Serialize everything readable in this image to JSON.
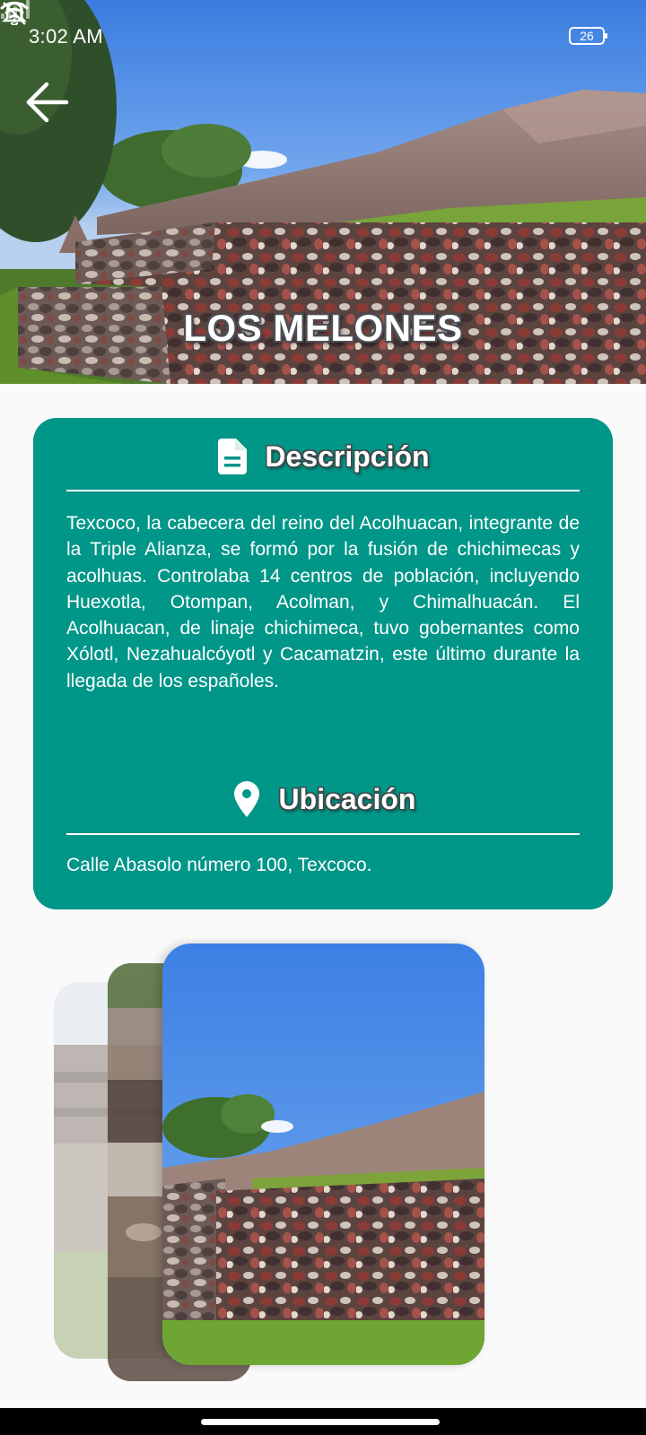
{
  "status_bar": {
    "time": "3:02 AM",
    "battery_level": "26",
    "icons": [
      "mute-icon",
      "signal-icon",
      "wifi-icon",
      "battery-icon"
    ]
  },
  "header": {
    "title": "LOS MELONES",
    "back_icon": "arrow-left-icon"
  },
  "description": {
    "heading": "Descripción",
    "icon": "document-icon",
    "text": "Texcoco, la cabecera del reino del Acolhuacan, integrante de la Triple Alianza, se formó por la fusión de chichimecas y acolhuas. Controlaba 14 centros de población, incluyendo Huexotla, Otompan, Acolman, y Chimalhuacán. El Acolhuacan, de linaje chichimeca, tuvo gobernantes como Xólotl, Nezahualcóyotl y Cacamatzin, este último durante la llegada de los españoles."
  },
  "location": {
    "heading": "Ubicación",
    "icon": "location-pin-icon",
    "text": "Calle Abasolo número 100, Texcoco."
  },
  "gallery": {
    "images": [
      "ruins-photo-1",
      "ruins-photo-2",
      "ruins-photo-3"
    ]
  },
  "colors": {
    "card_background": "#009688",
    "page_background": "#fafafa",
    "text": "#ffffff"
  }
}
